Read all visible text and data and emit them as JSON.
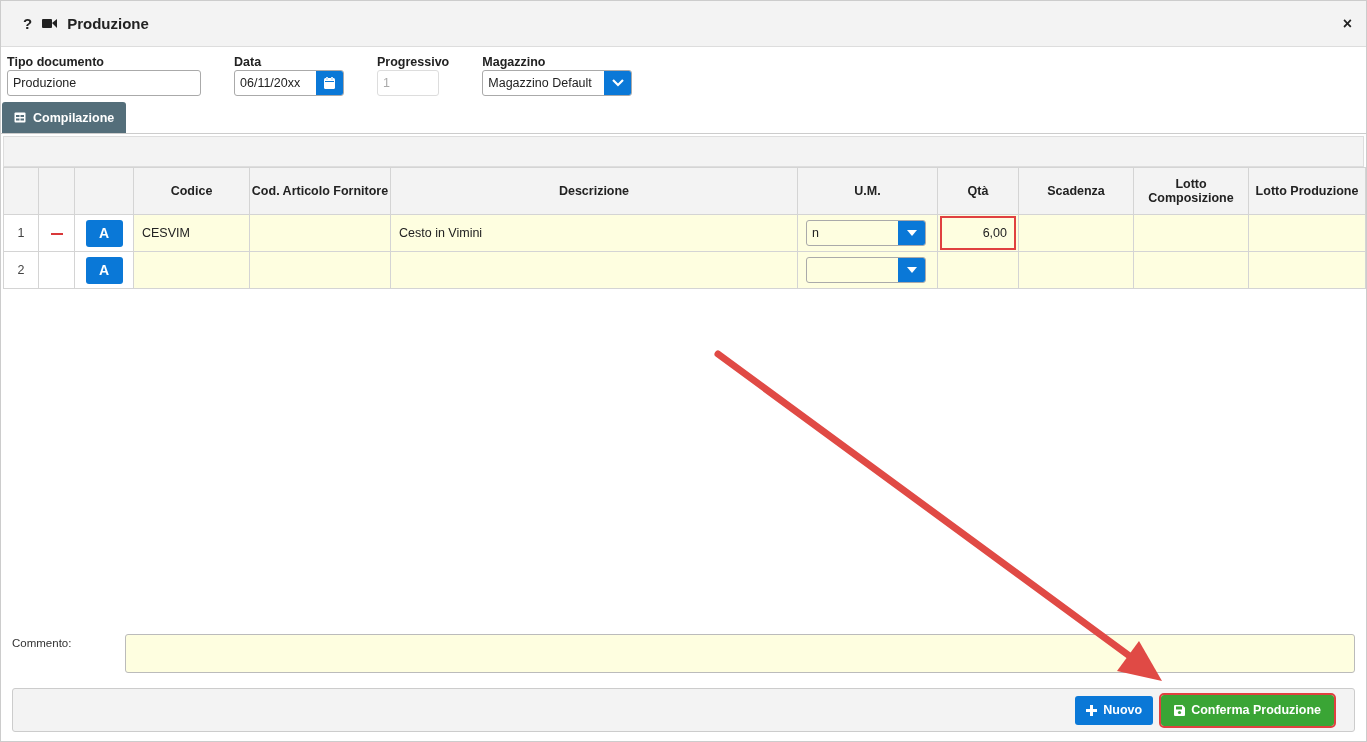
{
  "window": {
    "help": "?",
    "title": "Produzione",
    "close": "×"
  },
  "form": {
    "fields": [
      {
        "kind": "text",
        "label": "Tipo documento",
        "value": "Produzione",
        "disabled": false
      },
      {
        "kind": "date",
        "label": "Data",
        "value": "06/11/20xx",
        "disabled": false
      },
      {
        "kind": "text",
        "label": "Progressivo",
        "value": "1",
        "disabled": true
      },
      {
        "kind": "select",
        "label": "Magazzino",
        "value": "Magazzino Default",
        "disabled": false
      }
    ]
  },
  "tabs": [
    {
      "label": "Compilazione",
      "selected": true
    }
  ],
  "table": {
    "columns": [
      {
        "label": "Codice"
      },
      {
        "label": "Cod. Articolo Fornitore"
      },
      {
        "label": "Descrizione"
      },
      {
        "label": "U.M."
      },
      {
        "label": "Qtà"
      },
      {
        "label": "Scadenza"
      },
      {
        "label": "Lotto Composizione"
      },
      {
        "label": "Lotto Produzione"
      }
    ],
    "rows": [
      {
        "number": "1",
        "removable": true,
        "action": "A",
        "codice": "CESVIM",
        "descrizione": "Cesto in Vimini",
        "um": "n",
        "qta": "6,00",
        "qta_highlighted": true
      },
      {
        "number": "2",
        "removable": false,
        "action": "A",
        "qta_highlighted": false
      }
    ]
  },
  "comment": {
    "label": "Commento:"
  },
  "buttons": [
    {
      "kind": "new",
      "label": "Nuovo",
      "highlighted": false
    },
    {
      "kind": "save",
      "label": "Conferma Produzione",
      "highlighted": true
    }
  ],
  "annotations": [
    {
      "kind": "arrow"
    }
  ]
}
